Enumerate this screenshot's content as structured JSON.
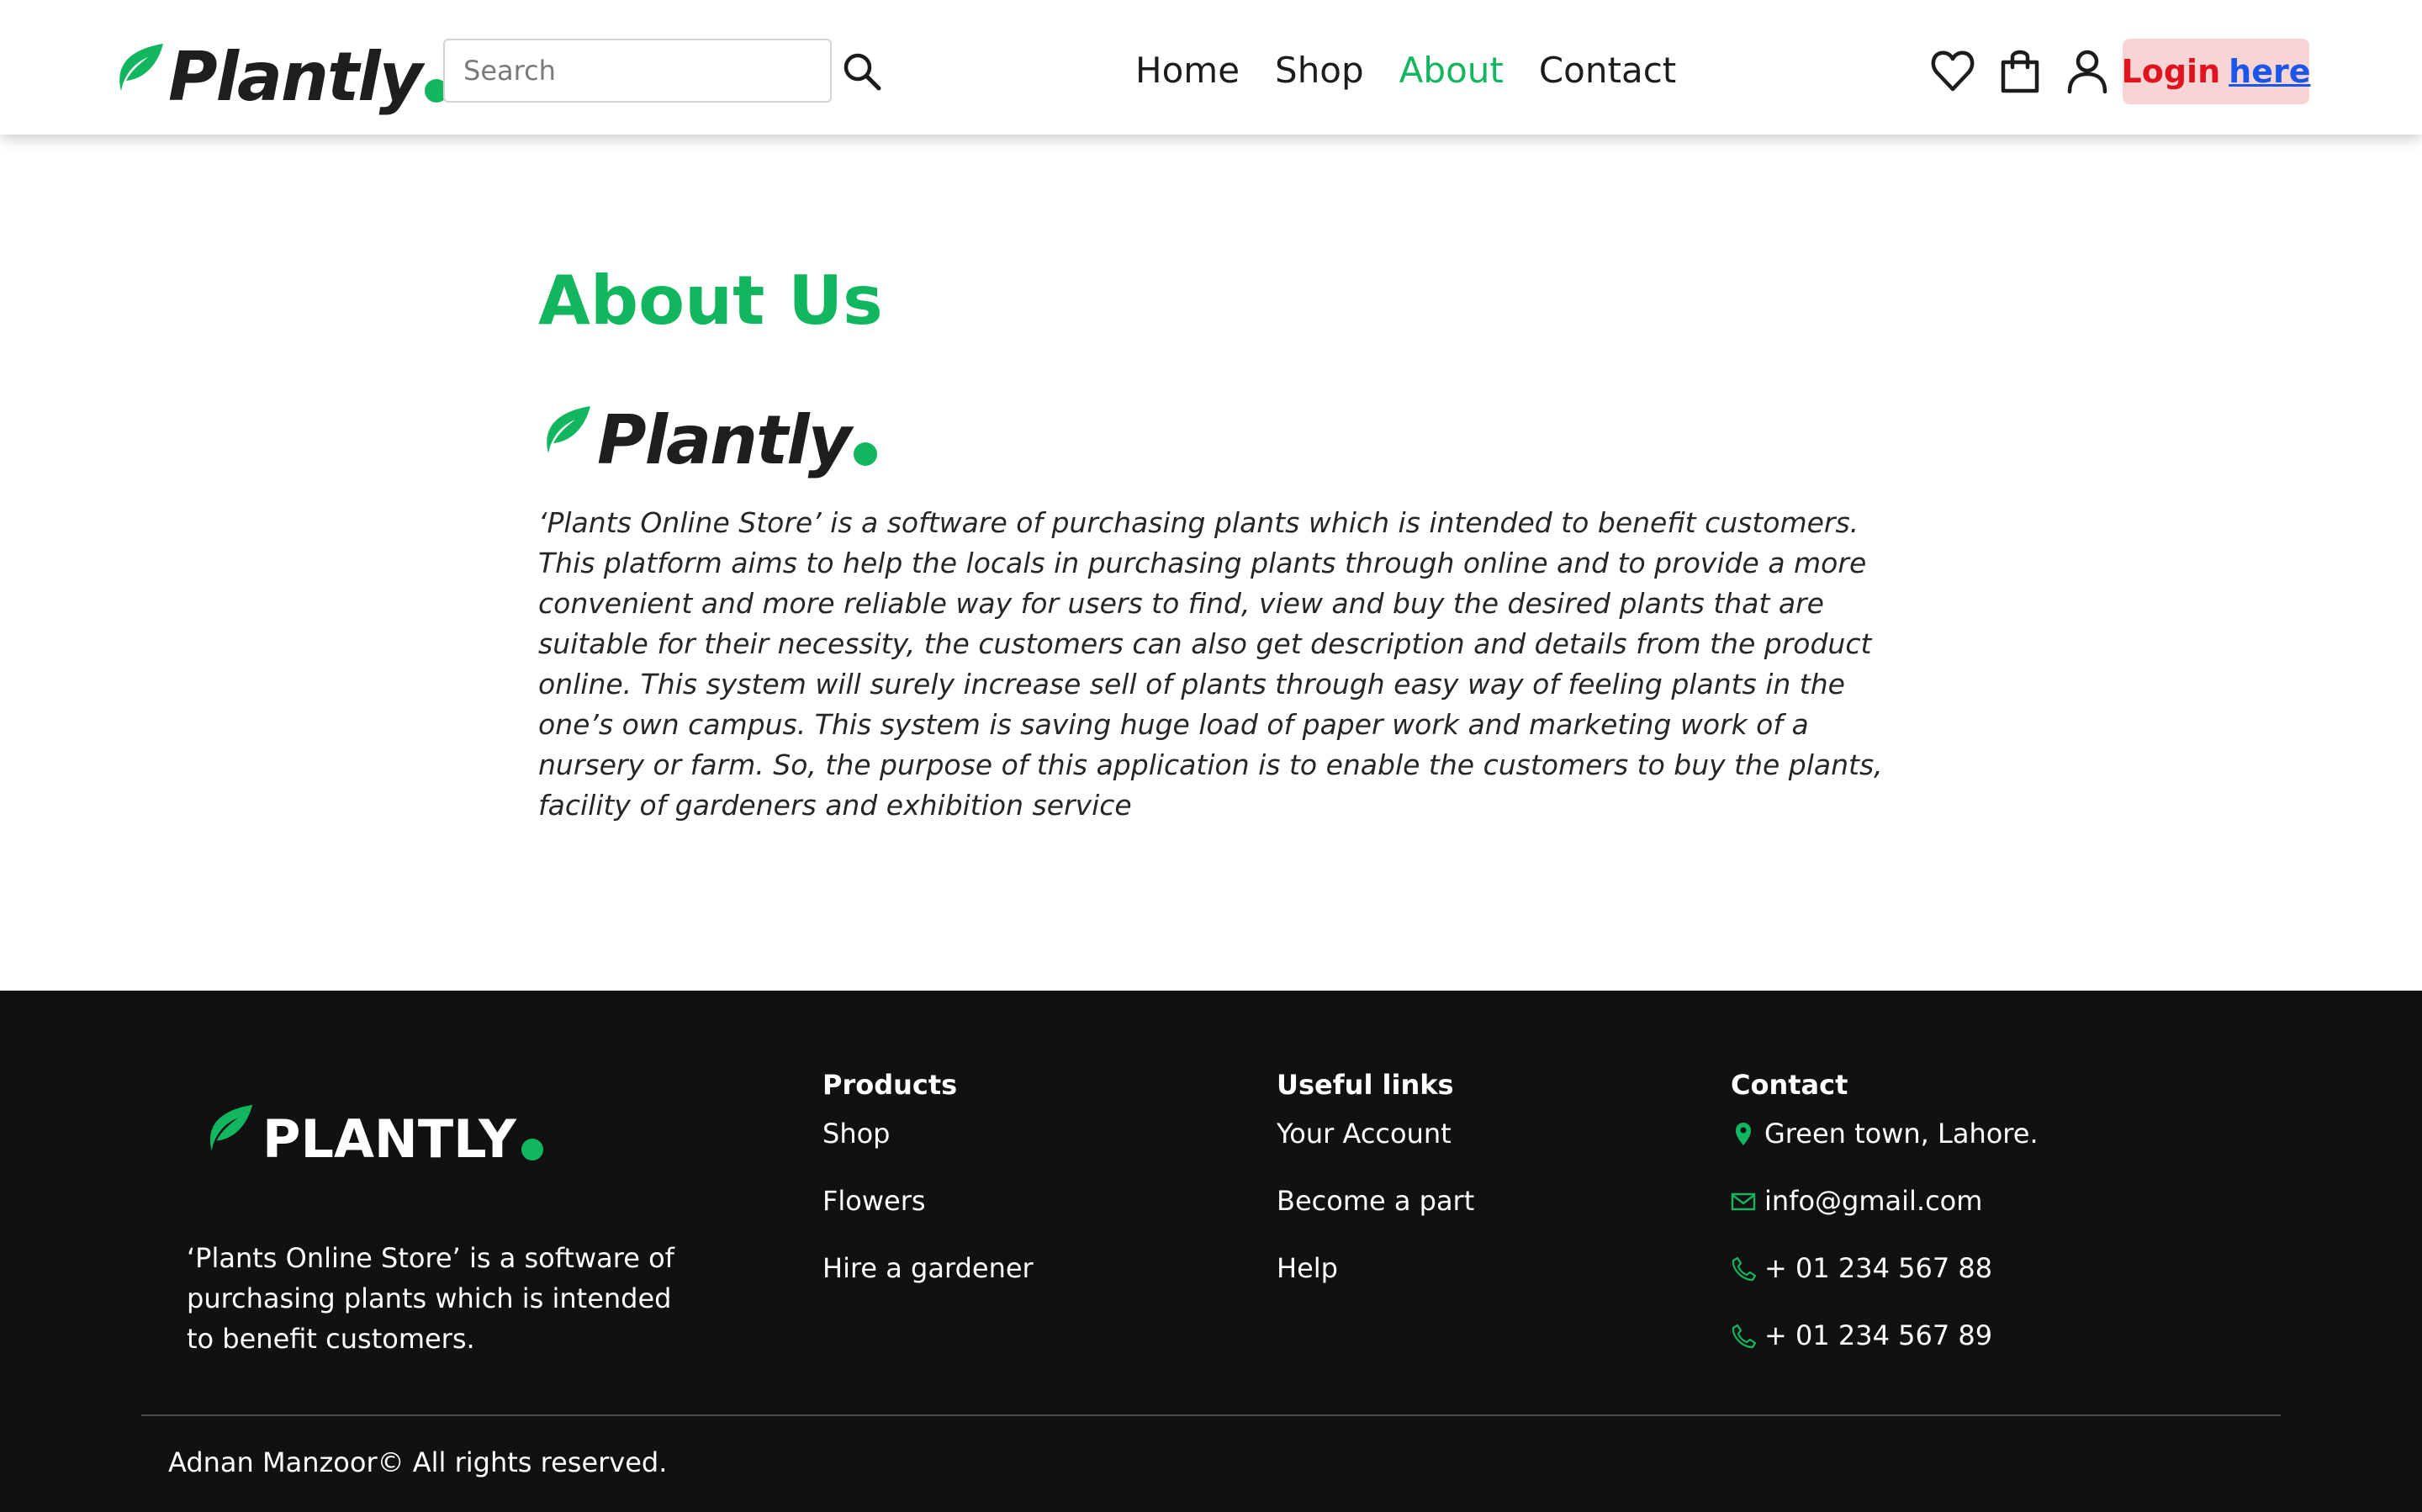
{
  "brand": {
    "name": "Plantly",
    "accent_color": "#12b65f",
    "leaf_icon": "leaf-icon"
  },
  "header": {
    "search": {
      "placeholder": "Search",
      "icon": "search-icon"
    },
    "nav": [
      {
        "label": "Home",
        "active": false
      },
      {
        "label": "Shop",
        "active": false
      },
      {
        "label": "About",
        "active": true
      },
      {
        "label": "Contact",
        "active": false
      }
    ],
    "icons": [
      "heart-icon",
      "shopping-bag-icon",
      "user-icon"
    ],
    "login": {
      "label": "Login",
      "link_text": "here",
      "bg_color": "#f9d4d4",
      "label_color": "#e0141e",
      "link_color": "#1a56e8"
    }
  },
  "main": {
    "title": "About Us",
    "logo_text": "Plantly",
    "description": "‘Plants Online Store’ is a software of purchasing plants which is intended to benefit customers. This platform aims to help the locals in purchasing plants through online and to provide a more convenient and more reliable way for users to find, view and buy the desired plants that are suitable for their necessity, the customers can also get description and details from the product online. This system will surely increase sell of plants through easy way of feeling plants in the one’s own campus. This system is saving huge load of paper work and marketing work of a nursery or farm. So, the purpose of this application is to enable the customers to buy the plants, facility of gardeners and exhibition service"
  },
  "footer": {
    "logo_text": "PLANTLY",
    "description": "‘Plants Online Store’ is a software of purchasing plants which is intended to benefit customers.",
    "columns": {
      "products": {
        "heading": "Products",
        "links": [
          "Shop",
          "Flowers",
          "Hire a gardener"
        ]
      },
      "useful_links": {
        "heading": "Useful links",
        "links": [
          "Your Account",
          "Become a part",
          "Help"
        ]
      },
      "contact": {
        "heading": "Contact",
        "items": [
          {
            "icon": "location-pin-icon",
            "text": "Green town, Lahore."
          },
          {
            "icon": "mail-icon",
            "text": "info@gmail.com"
          },
          {
            "icon": "phone-icon",
            "text": "+ 01 234 567 88"
          },
          {
            "icon": "phone-icon",
            "text": "+ 01 234 567 89"
          }
        ]
      }
    },
    "copyright": "Adnan Manzoor© All rights reserved.",
    "background_color": "#111111"
  }
}
